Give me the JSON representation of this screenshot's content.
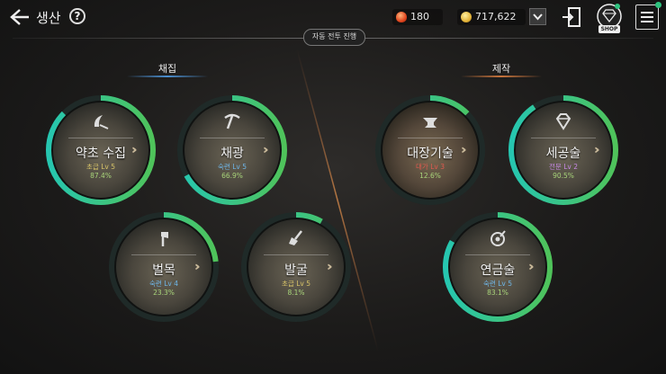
{
  "header": {
    "title": "생산",
    "help_label": "?",
    "fire_value": "180",
    "gold_value": "717,622",
    "shop_label": "SHOP",
    "auto_button": "자동 전투 진행"
  },
  "sections": {
    "gather": "채집",
    "craft": "제작"
  },
  "skills": {
    "herb": {
      "name": "약초 수집",
      "level": "초급 Lv 5",
      "percent": "87.4%",
      "progress": 0.874
    },
    "mining": {
      "name": "채광",
      "level": "숙련 Lv 5",
      "percent": "66.9%",
      "progress": 0.669
    },
    "logging": {
      "name": "벌목",
      "level": "숙련 Lv 4",
      "percent": "23.3%",
      "progress": 0.233
    },
    "digging": {
      "name": "발굴",
      "level": "초급 Lv 5",
      "percent": "8.1%",
      "progress": 0.081
    },
    "smithing": {
      "name": "대장기술",
      "level": "대가 Lv 3",
      "percent": "12.6%",
      "progress": 0.126
    },
    "jewel": {
      "name": "세공술",
      "level": "전문 Lv 2",
      "percent": "90.5%",
      "progress": 0.905
    },
    "alchemy": {
      "name": "연금술",
      "level": "숙련 Lv 5",
      "percent": "83.1%",
      "progress": 0.831
    }
  },
  "colors": {
    "ring_teal": "#26c6b0",
    "ring_green": "#4fc35a",
    "level_basic": "#d8c468",
    "level_skilled": "#6fb6e8",
    "level_master": "#e05a4f",
    "level_expert": "#c98ae8"
  },
  "icons": {
    "back": "back-arrow-icon",
    "fire": "fire-gem-icon",
    "gold": "gold-coin-icon",
    "exit": "exit-door-icon",
    "shop": "shop-diamond-icon",
    "menu": "menu-list-icon"
  }
}
